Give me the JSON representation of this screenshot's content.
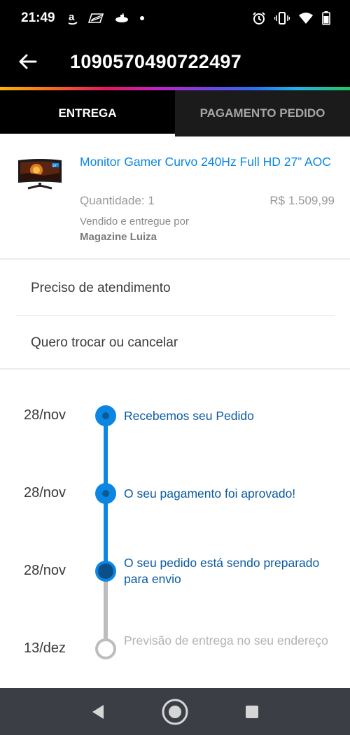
{
  "status_bar": {
    "time": "21:49",
    "left_icons": [
      "amazon-icon",
      "flag-icon",
      "submarine-icon",
      "dot-icon"
    ],
    "right_icons": [
      "alarm-icon",
      "vibrate-icon",
      "wifi-icon",
      "battery-icon"
    ]
  },
  "app_bar": {
    "title": "1090570490722497"
  },
  "tabs": [
    {
      "label": "ENTREGA",
      "active": true
    },
    {
      "label": "PAGAMENTO PEDIDO",
      "active": false
    }
  ],
  "product": {
    "name": "Monitor Gamer Curvo 240Hz Full HD 27” AOC",
    "quantity": "Quantidade: 1",
    "price": "R$ 1.509,99",
    "seller_label": "Vendido e entregue por",
    "seller_name": "Magazine Luiza",
    "thumb_badge": "27\""
  },
  "actions": [
    {
      "label": "Preciso de atendimento"
    },
    {
      "label": "Quero trocar ou cancelar"
    }
  ],
  "timeline": [
    {
      "date": "28/nov",
      "text": "Recebemos seu Pedido",
      "status": "done"
    },
    {
      "date": "28/nov",
      "text": "O seu pagamento foi aprovado!",
      "status": "done"
    },
    {
      "date": "28/nov",
      "text": "O seu pedido está sendo preparado para envio",
      "status": "current"
    },
    {
      "date": "13/dez",
      "text": "Previsão de entrega no seu endereço",
      "status": "pending"
    }
  ],
  "colors": {
    "accent": "#0b86e2",
    "active_text": "#0b5aa0",
    "pending": "#bdbdbd"
  },
  "nav_bar": [
    "back-nav-icon",
    "home-nav-icon",
    "recents-nav-icon"
  ]
}
